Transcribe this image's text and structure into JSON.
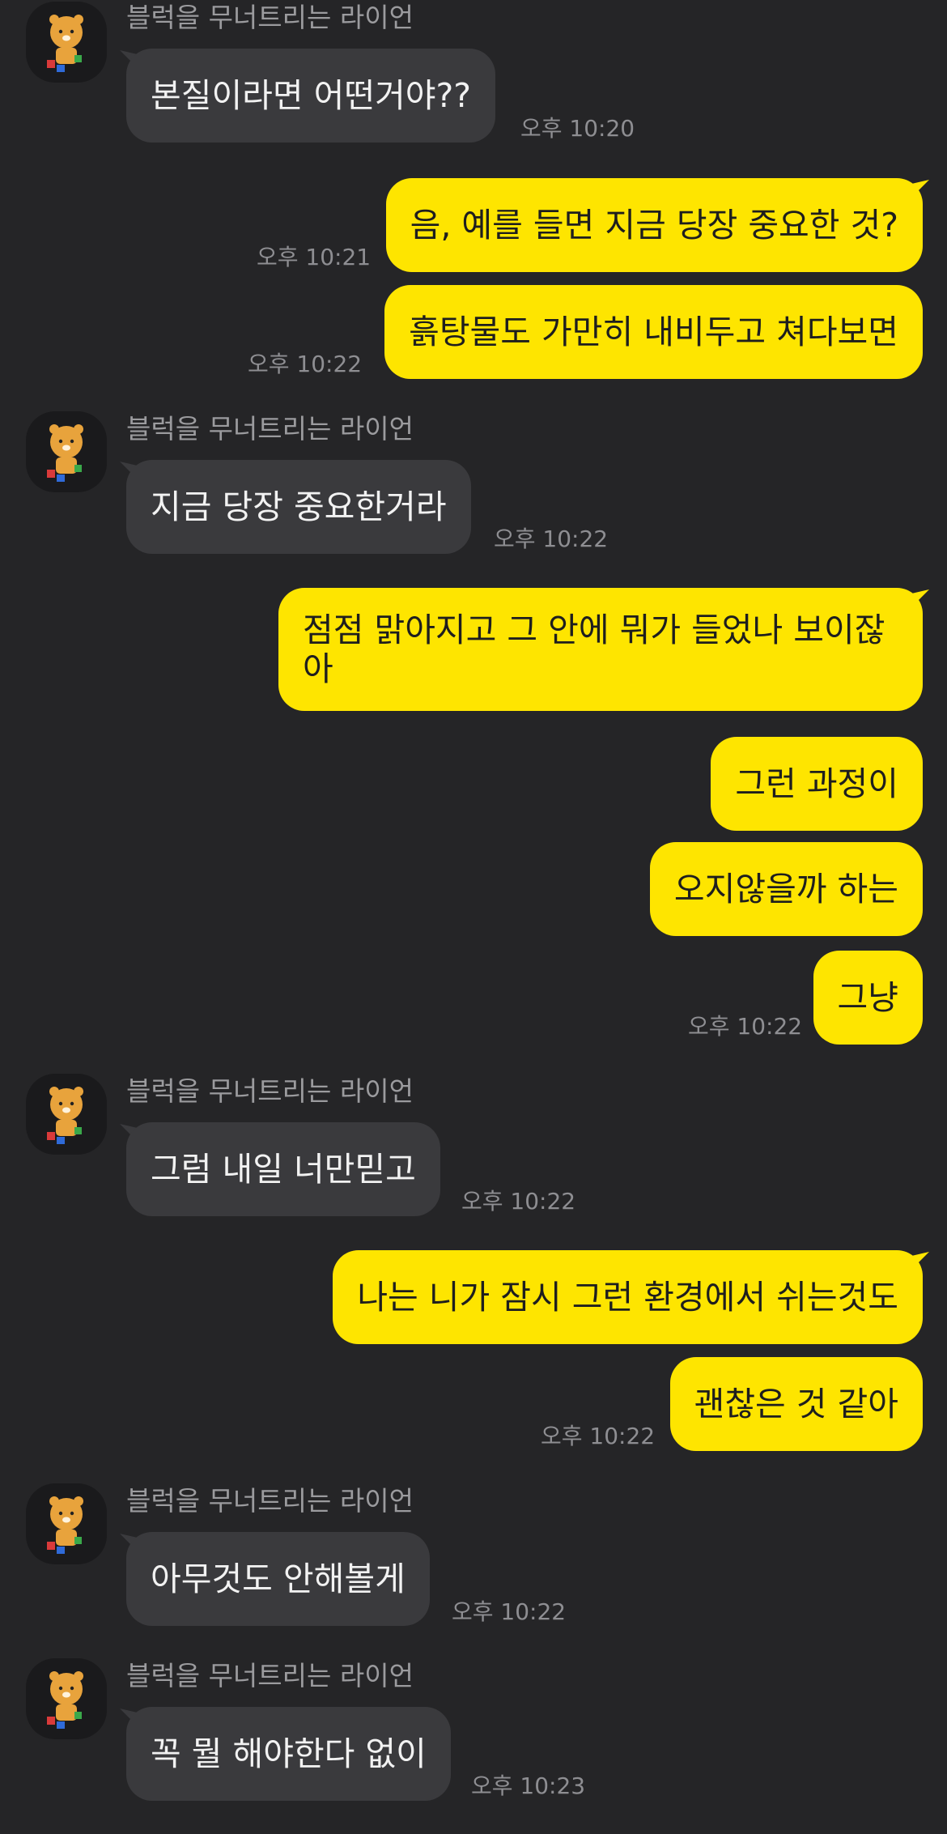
{
  "sender_name": "블럭을 무너트리는 라이언",
  "messages": [
    {
      "text": "본질이라면 어떤거야??",
      "time": "오후 10:20"
    },
    {
      "text": "음, 예를 들면 지금 당장 중요한 것?",
      "time": "오후 10:21"
    },
    {
      "text": "흙탕물도 가만히 내비두고 쳐다보면",
      "time": "오후 10:22"
    },
    {
      "text": "지금 당장 중요한거라",
      "time": "오후 10:22"
    },
    {
      "text": "점점 맑아지고 그 안에 뭐가 들었나 보이잖아"
    },
    {
      "text": "그런 과정이"
    },
    {
      "text": "오지않을까 하는"
    },
    {
      "text": "그냥",
      "time": "오후 10:22"
    },
    {
      "text": "그럼 내일 너만믿고",
      "time": "오후 10:22"
    },
    {
      "text": "나는 니가 잠시 그런 환경에서 쉬는것도"
    },
    {
      "text": "괜찮은 것 같아",
      "time": "오후 10:22"
    },
    {
      "text": "아무것도 안해볼게",
      "time": "오후 10:22"
    },
    {
      "text": "꼭 뭘 해야한다 없이",
      "time": "오후 10:23"
    }
  ],
  "colors": {
    "background": "#252527",
    "incoming_bubble": "#3a3a3d",
    "outgoing_bubble": "#fee500"
  },
  "icons": {
    "avatar": "ryan-character-avatar"
  }
}
